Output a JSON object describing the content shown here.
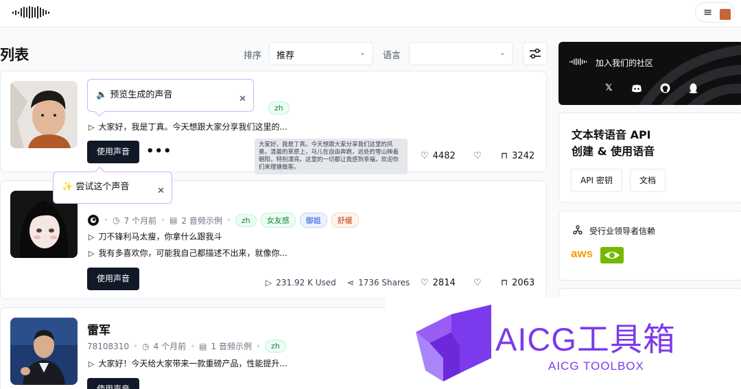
{
  "header": {
    "menu_icon": "≡"
  },
  "toolbar": {
    "title": "列表",
    "sort_label": "排序",
    "sort_value": "推荐",
    "lang_label": "语言",
    "lang_value": ""
  },
  "cards": [
    {
      "tags": [
        "zh"
      ],
      "samples": [
        "大家好，我是丁真。今天想跟大家分享我们这里的..."
      ],
      "use_label": "使用声音",
      "likes": "4482",
      "saves": "3242",
      "tooltip": "大家好，我是丁真。今天想跟大家分享我们这里的风景。清晨的草原上，马儿在自由奔跑，远处的雪山映着朝阳，特别漂亮。这里的一切都让我感到幸福，欢迎你们来理塘做客。"
    },
    {
      "time": "7 个月前",
      "samples_count": "2 音频示例",
      "tags": [
        "zh",
        "女友感",
        "御姐",
        "舒缓"
      ],
      "samples": [
        "刀不锋利马太瘦，你拿什么跟我斗",
        "我有多喜欢你，可能我自己都描述不出来，就像你..."
      ],
      "use_label": "使用声音",
      "used": "231.92 K Used",
      "shares": "1736 Shares",
      "likes": "2814",
      "saves": "2063"
    },
    {
      "name": "雷军",
      "id": "78108310",
      "time": "4 个月前",
      "samples_count": "1 音频示例",
      "tags": [
        "zh"
      ],
      "samples": [
        "大家好！今天给大家带来一款重磅产品，性能提升..."
      ],
      "use_label": "使用声音"
    }
  ],
  "popovers": {
    "preview": "🔈 预览生成的声音",
    "try": "✨ 尝试这个声音",
    "close": "✕"
  },
  "sidebar": {
    "community_title": "加入我们的社区",
    "social": [
      "X",
      "Discord",
      "GitHub",
      "QQ"
    ],
    "api_title_1": "文本转语音 API",
    "api_title_2": "创建 & 使用语音",
    "api_key_label": "API 密钥",
    "docs_label": "文档",
    "trust_title": "受行业领导者信赖",
    "aws_label": "aws"
  },
  "watermark": {
    "title": "AICG工具箱",
    "subtitle": "AICG TOOLBOX"
  },
  "colors": {
    "accent": "#7c3aed",
    "button": "#111827",
    "popover_border": "#c4b5fd"
  }
}
